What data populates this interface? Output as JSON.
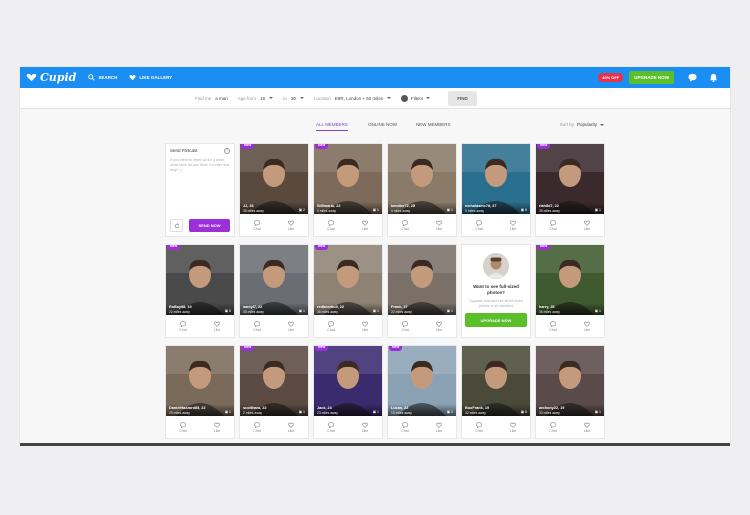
{
  "brand": {
    "logo_text": "Cupid"
  },
  "nav": {
    "search_label": "SEARCH",
    "gallery_label": "LIKE GALLERY"
  },
  "topbar": {
    "discount_badge": "40% OFF",
    "upgrade_label": "UPGRADE NOW"
  },
  "filter": {
    "find_label": "Find me",
    "find_value": "a man",
    "age_from_label": "Age from",
    "age_from_value": "18",
    "age_to_label": "to",
    "age_to_value": "30",
    "location_label": "Location",
    "location_value": "E8R, London + 50 miles",
    "filters_label": "Filters",
    "find_button": "FIND"
  },
  "tabs": {
    "all": "ALL MEMBERS",
    "online": "ONLINE NOW",
    "new": "NEW MEMBERS"
  },
  "sort": {
    "label": "Sort by",
    "value": "Popularity"
  },
  "flirt": {
    "title": "Send Flirtcast",
    "prompt": "If you were to meet up for a drink, what drink do you think I'd order and why? :)",
    "send_label": "SEND NOW"
  },
  "promo": {
    "title": "Want to see full-sized photos?",
    "subtitle": "Upgrade now and see all full sized photos of all members",
    "button": "UPGRADE NOW"
  },
  "actions": {
    "chat": "Chat",
    "like": "Like"
  },
  "new_label": "New",
  "members": [
    {
      "name": "JJ, 26",
      "distance": "35 miles away",
      "photos": "2",
      "new": true,
      "bg": "#5a4a3e"
    },
    {
      "name": "Sil9mario, 22",
      "distance": "0 miles away",
      "photos": "1",
      "new": true,
      "bg": "#7d6a5a"
    },
    {
      "name": "kendler72, 25",
      "distance": "0 miles away",
      "photos": "1",
      "new": false,
      "bg": "#8a7a68"
    },
    {
      "name": "nicholasmc78, 27",
      "distance": "0 miles away",
      "photos": "6",
      "new": false,
      "bg": "#2b6f8e"
    },
    {
      "name": "riah8d7, 22",
      "distance": "35 miles away",
      "photos": "1",
      "new": true,
      "bg": "#3a2a2e"
    },
    {
      "name": "RoBay98, 19",
      "distance": "22 miles away",
      "photos": "5",
      "new": true,
      "bg": "#4a4a4a"
    },
    {
      "name": "samyl7, 22",
      "distance": "35 miles away",
      "photos": "1",
      "new": false,
      "bg": "#6a6e74"
    },
    {
      "name": "redbeerbull, 22",
      "distance": "36 miles away",
      "photos": "1",
      "new": true,
      "bg": "#8e8274"
    },
    {
      "name": "Frank, 27",
      "distance": "22 miles away",
      "photos": "1",
      "new": false,
      "bg": "#7a7068"
    },
    {
      "name": "harry, 25",
      "distance": "36 miles away",
      "photos": "1",
      "new": true,
      "bg": "#3e5a2e"
    },
    {
      "name": "DanielHazzard85, 22",
      "distance": "29 miles away",
      "photos": "1",
      "new": false,
      "bg": "#7a6a5a"
    },
    {
      "name": "scotthara, 22",
      "distance": "2 miles away",
      "photos": "1",
      "new": true,
      "bg": "#5a4a42"
    },
    {
      "name": "Jack, 24",
      "distance": "23 miles away",
      "photos": "1",
      "new": true,
      "bg": "#3a2a6e"
    },
    {
      "name": "Lucas, 22",
      "distance": "15 miles away",
      "photos": "1",
      "new": true,
      "bg": "#8aa2b4"
    },
    {
      "name": "BooFrank, 19",
      "distance": "32 miles away",
      "photos": "6",
      "new": false,
      "bg": "#4a4a3a"
    },
    {
      "name": "anthony22, 19",
      "distance": "33 miles away",
      "photos": "1",
      "new": false,
      "bg": "#5a4a4a"
    }
  ]
}
